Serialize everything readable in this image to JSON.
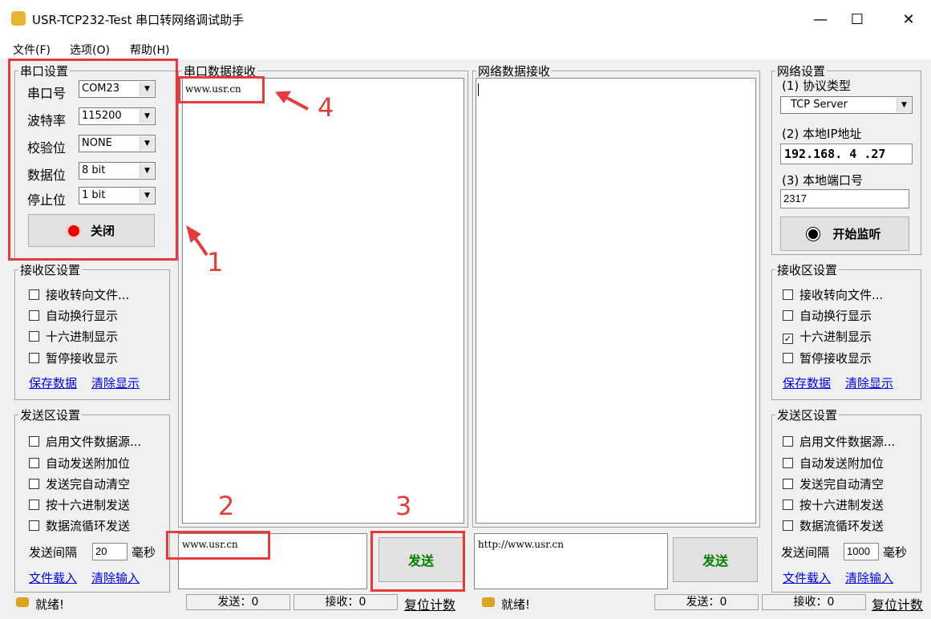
{
  "window": {
    "title": "USR-TCP232-Test 串口转网络调试助手",
    "icon": "app-icon",
    "controls": [
      "—",
      "☐",
      "✕"
    ]
  },
  "menu": [
    "文件(F)",
    "选项(O)",
    "帮助(H)"
  ],
  "serial_settings": {
    "legend": "串口设置",
    "port_label": "串口号",
    "port_value": "COM23",
    "baud_label": "波特率",
    "baud_value": "115200",
    "parity_label": "校验位",
    "parity_value": "NONE",
    "databits_label": "数据位",
    "databits_value": "8 bit",
    "stopbits_label": "停止位",
    "stopbits_value": "1 bit",
    "toggle_label": "关闭"
  },
  "left_receive": {
    "legend": "接收区设置",
    "options": [
      {
        "label": "接收转向文件...",
        "checked": false
      },
      {
        "label": "自动换行显示",
        "checked": false
      },
      {
        "label": "十六进制显示",
        "checked": false
      },
      {
        "label": "暂停接收显示",
        "checked": false
      }
    ],
    "save_link": "保存数据",
    "clear_link": "清除显示"
  },
  "left_send": {
    "legend": "发送区设置",
    "options": [
      {
        "label": "启用文件数据源...",
        "checked": false
      },
      {
        "label": "自动发送附加位",
        "checked": false
      },
      {
        "label": "发送完自动清空",
        "checked": false
      },
      {
        "label": "按十六进制发送",
        "checked": false
      },
      {
        "label": "数据流循环发送",
        "checked": false
      }
    ],
    "interval_label": "发送间隔",
    "interval_value": "20",
    "interval_unit": "毫秒",
    "load_link": "文件载入",
    "clear_link": "清除输入"
  },
  "serial_receive": {
    "legend": "串口数据接收",
    "content": "www.usr.cn"
  },
  "net_receive": {
    "legend": "网络数据接收",
    "content": ""
  },
  "serial_send": {
    "input": "www.usr.cn",
    "button": "发送"
  },
  "net_send": {
    "input": "http://www.usr.cn",
    "button": "发送"
  },
  "net_settings": {
    "legend": "网络设置",
    "protocol_label": "(1) 协议类型",
    "protocol_value": "TCP Server",
    "ip_label": "(2) 本地IP地址",
    "ip_value": "192.168. 4 .27",
    "port_label": "(3) 本地端口号",
    "port_value": "2317",
    "listen_button": "开始监听"
  },
  "right_receive": {
    "legend": "接收区设置",
    "options": [
      {
        "label": "接收转向文件...",
        "checked": false
      },
      {
        "label": "自动换行显示",
        "checked": false
      },
      {
        "label": "十六进制显示",
        "checked": true
      },
      {
        "label": "暂停接收显示",
        "checked": false
      }
    ],
    "save_link": "保存数据",
    "clear_link": "清除显示"
  },
  "right_send": {
    "legend": "发送区设置",
    "options": [
      {
        "label": "启用文件数据源...",
        "checked": false
      },
      {
        "label": "自动发送附加位",
        "checked": false
      },
      {
        "label": "发送完自动清空",
        "checked": false
      },
      {
        "label": "按十六进制发送",
        "checked": false
      },
      {
        "label": "数据流循环发送",
        "checked": false
      }
    ],
    "interval_label": "发送间隔",
    "interval_value": "1000",
    "interval_unit": "毫秒",
    "load_link": "文件载入",
    "clear_link": "清除输入"
  },
  "status_left": {
    "ready": "就绪!",
    "sent": "发送：0",
    "received": "接收：0",
    "reset": "复位计数"
  },
  "status_right": {
    "ready": "就绪!",
    "sent": "发送：0",
    "received": "接收：0",
    "reset": "复位计数"
  },
  "annotations": [
    "1",
    "2",
    "3",
    "4"
  ],
  "colors": {
    "annotation": "#e53b3b",
    "link": "#0000ee",
    "send_text": "#008000"
  }
}
